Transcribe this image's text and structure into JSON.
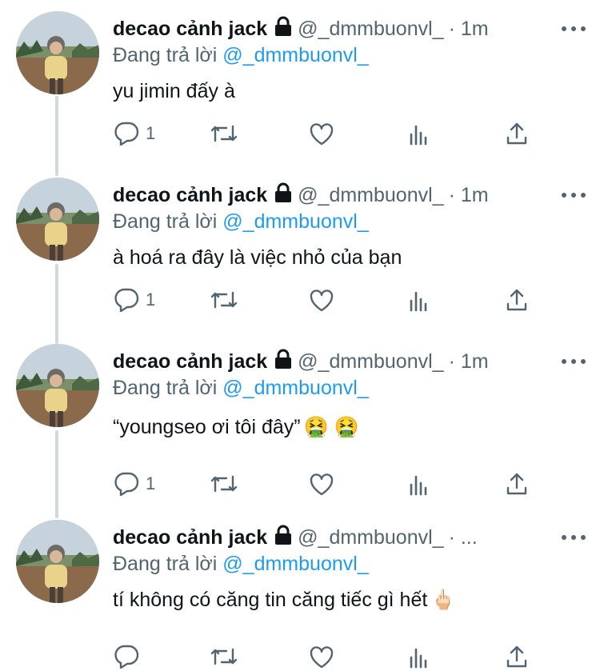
{
  "colors": {
    "link": "#1d9bf0",
    "muted": "#536471",
    "text": "#0f1419",
    "thread": "#cfd9de"
  },
  "tweets": [
    {
      "name": "decao cảnh jack",
      "handle": "@_dmmbuonvl_",
      "time": "· 1m",
      "reply_prefix": "Đang trả lời",
      "reply_to": "@_dmmbuonvl_",
      "text": "yu jimin đấy à",
      "reply_count": "1",
      "emoji": ""
    },
    {
      "name": "decao cảnh jack",
      "handle": "@_dmmbuonvl_",
      "time": "· 1m",
      "reply_prefix": "Đang trả lời",
      "reply_to": "@_dmmbuonvl_",
      "text": "à hoá ra đây là việc nhỏ của bạn",
      "reply_count": "1",
      "emoji": ""
    },
    {
      "name": "decao cảnh jack",
      "handle": "@_dmmbuonvl_",
      "time": "· 1m",
      "reply_prefix": "Đang trả lời",
      "reply_to": "@_dmmbuonvl_",
      "text": "“youngseo ơi tôi đây”",
      "reply_count": "1",
      "emoji": "🤮 🤮"
    },
    {
      "name": "decao cảnh jack",
      "handle": "@_dmmbuonvl_",
      "time": "· ...",
      "reply_prefix": "Đang trả lời",
      "reply_to": "@_dmmbuonvl_",
      "text": "tí không có căng tin căng tiếc gì hết",
      "reply_count": "",
      "emoji": "🖕🏻"
    }
  ],
  "icons": [
    "lock-icon",
    "more-icon",
    "reply-icon",
    "retweet-icon",
    "like-icon",
    "views-icon",
    "share-icon"
  ]
}
